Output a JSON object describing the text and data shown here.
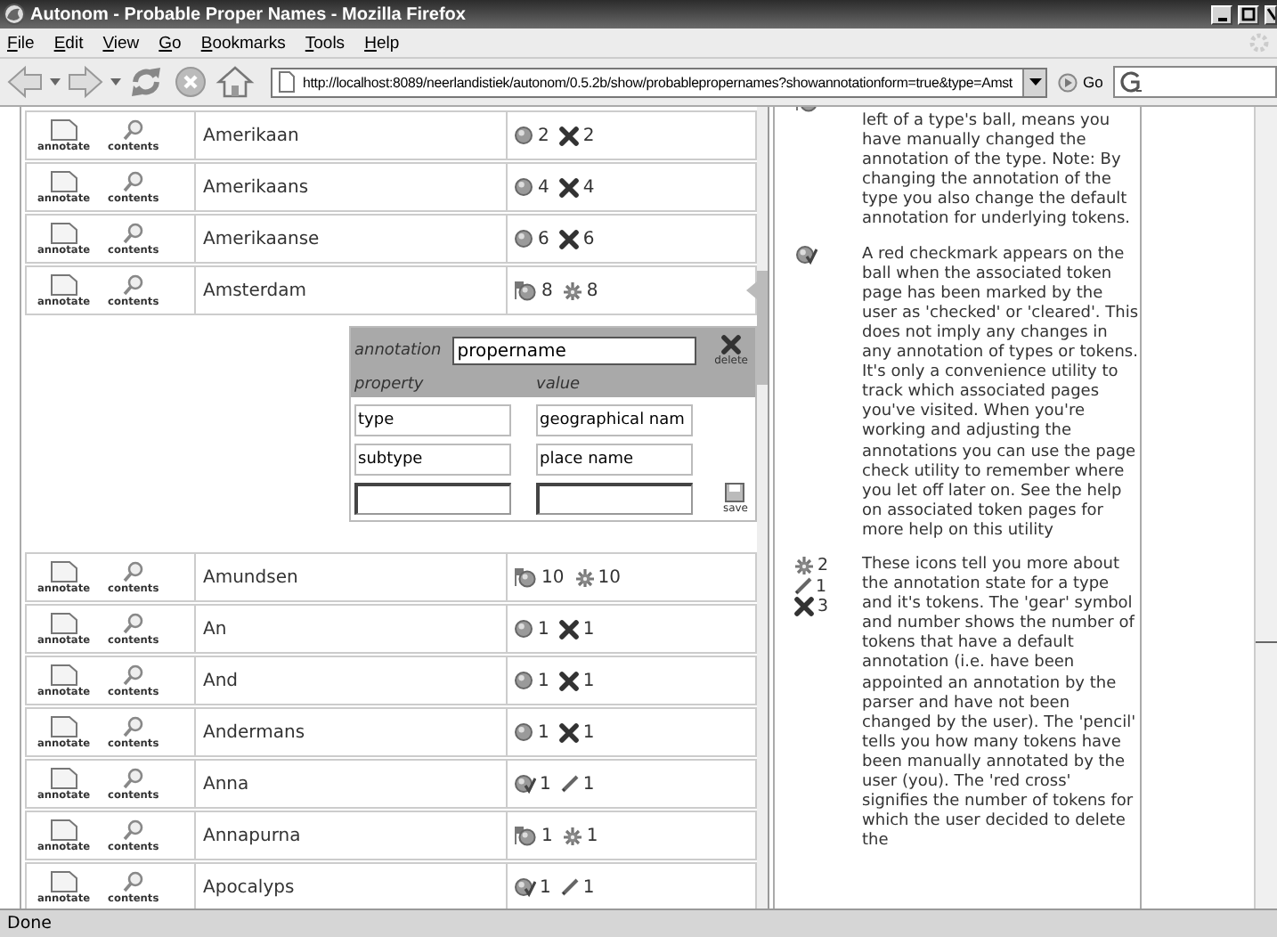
{
  "window": {
    "title": "Autonom - Probable Proper Names - Mozilla Firefox"
  },
  "menu": [
    "File",
    "Edit",
    "View",
    "Go",
    "Bookmarks",
    "Tools",
    "Help"
  ],
  "address_bar": {
    "url": "http://localhost:8089/neerlandistiek/autonom/0.5.2b/show/probablepropernames?showannotationform=true&type=Amst"
  },
  "go_button": "Go",
  "types_before": [
    {
      "name": "Amerikaan",
      "selected": false,
      "actions": [
        "annotate",
        "contents"
      ],
      "stats": [
        {
          "kind": "ball",
          "count": "2"
        },
        {
          "kind": "cross",
          "count": "2"
        }
      ]
    },
    {
      "name": "Amerikaans",
      "selected": false,
      "actions": [
        "annotate",
        "contents"
      ],
      "stats": [
        {
          "kind": "ball",
          "count": "4"
        },
        {
          "kind": "cross",
          "count": "4"
        }
      ]
    },
    {
      "name": "Amerikaanse",
      "selected": false,
      "actions": [
        "annotate",
        "contents"
      ],
      "stats": [
        {
          "kind": "ball",
          "count": "6"
        },
        {
          "kind": "cross",
          "count": "6"
        }
      ]
    },
    {
      "name": "Amsterdam",
      "selected": true,
      "actions": [
        "annotate",
        "contents"
      ],
      "stats": [
        {
          "kind": "flagged-ball",
          "count": "8"
        },
        {
          "kind": "gear",
          "count": "8"
        }
      ]
    }
  ],
  "annotation_form": {
    "annotation_label": "annotation",
    "annotation_value": "propername",
    "delete_label": "delete",
    "property_header": "property",
    "value_header": "value",
    "save_label": "save",
    "properties": [
      {
        "kind": "filled",
        "property": "type",
        "value": "geographical nam"
      },
      {
        "kind": "filled",
        "property": "subtype",
        "value": "place name"
      },
      {
        "kind": "entry"
      }
    ]
  },
  "types_after": [
    {
      "name": "Amundsen",
      "selected": false,
      "actions": [
        "annotate",
        "contents"
      ],
      "stats": [
        {
          "kind": "flagged-ball",
          "count": "10"
        },
        {
          "kind": "gear",
          "count": "10"
        }
      ]
    },
    {
      "name": "An",
      "selected": false,
      "actions": [
        "annotate",
        "contents"
      ],
      "stats": [
        {
          "kind": "ball",
          "count": "1"
        },
        {
          "kind": "cross",
          "count": "1"
        }
      ]
    },
    {
      "name": "And",
      "selected": false,
      "actions": [
        "annotate",
        "contents"
      ],
      "stats": [
        {
          "kind": "ball",
          "count": "1"
        },
        {
          "kind": "cross",
          "count": "1"
        }
      ]
    },
    {
      "name": "Andermans",
      "selected": false,
      "actions": [
        "annotate",
        "contents"
      ],
      "stats": [
        {
          "kind": "ball",
          "count": "1"
        },
        {
          "kind": "cross",
          "count": "1"
        }
      ]
    },
    {
      "name": "Anna",
      "selected": false,
      "actions": [
        "annotate",
        "contents"
      ],
      "stats": [
        {
          "kind": "checked-ball",
          "count": "1"
        },
        {
          "kind": "pencil",
          "count": "1"
        }
      ]
    },
    {
      "name": "Annapurna",
      "selected": false,
      "actions": [
        "annotate",
        "contents"
      ],
      "stats": [
        {
          "kind": "flagged-ball",
          "count": "1"
        },
        {
          "kind": "gear",
          "count": "1"
        }
      ]
    },
    {
      "name": "Apocalyps",
      "selected": false,
      "actions": [
        "annotate",
        "contents"
      ],
      "stats": [
        {
          "kind": "checked-ball",
          "count": "1"
        },
        {
          "kind": "pencil",
          "count": "1"
        }
      ]
    }
  ],
  "help": [
    {
      "icons": [
        {
          "kind": "flagged-ball"
        }
      ],
      "text": "left of a type's ball, means you have manually changed the annotation of the type. Note: By changing the annotation of the type you also change the default annotation for underlying tokens."
    },
    {
      "icons": [
        {
          "kind": "checked-ball"
        }
      ],
      "text": "A red checkmark appears on the ball when the associated token page has been marked by the user as 'checked' or 'cleared'. This does not imply any changes in any annotation of types or tokens. It's only a convenience utility to track which associated pages you've visited. When you're working and adjusting the annotations you can use the page check utility to remember where you let off later on. See the help on associated token pages for more help on this utility"
    },
    {
      "icons": [
        {
          "kind": "gear",
          "count": "2"
        },
        {
          "kind": "pencil",
          "count": "1"
        },
        {
          "kind": "cross",
          "count": "3"
        }
      ],
      "text": "These icons tell you more about the annotation state for a type and it's tokens. The 'gear' symbol and number shows the number of tokens that have a default annotation (i.e. have been appointed an annotation by the parser and have not been changed by the user). The 'pencil' tells you how many tokens have been manually annotated by the user (you). The 'red cross' signifies the number of tokens for which the user decided to delete the"
    }
  ],
  "status_bar": "Done"
}
